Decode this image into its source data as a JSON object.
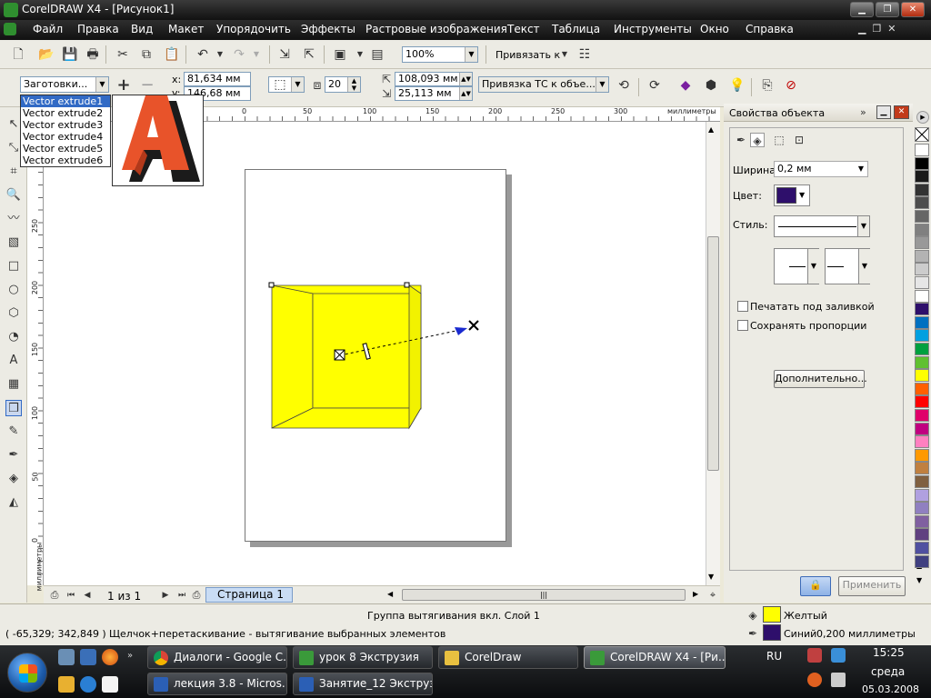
{
  "window": {
    "title": "CorelDRAW X4 - [Рисунок1]"
  },
  "menu": [
    "Файл",
    "Правка",
    "Вид",
    "Макет",
    "Упорядочить",
    "Эффекты",
    "Растровые изображения",
    "Текст",
    "Таблица",
    "Инструменты",
    "Окно",
    "Справка"
  ],
  "standard_toolbar": {
    "zoom": "100%",
    "snap_label": "Привязать к"
  },
  "property_bar": {
    "presets_value": "Заготовки...",
    "x": "81,634 мм",
    "y": "146,68 мм",
    "depth": "20",
    "vp_x": "108,093 мм",
    "vp_y": "25,113 мм",
    "vp_lock": "Привязка ТС к объе..."
  },
  "presets_list": {
    "items": [
      "Vector extrude1",
      "Vector extrude2",
      "Vector extrude3",
      "Vector extrude4",
      "Vector extrude5",
      "Vector extrude6"
    ],
    "selected_index": 0
  },
  "ruler": {
    "unit": "миллиметры",
    "h_ticks": [
      "0",
      "50",
      "100",
      "150",
      "200",
      "250",
      "300"
    ],
    "v_ticks": [
      "250",
      "200",
      "150",
      "100",
      "50",
      "0"
    ],
    "v_unit": "миллиметры"
  },
  "page_nav": {
    "counter": "1 из 1",
    "tab": "Страница 1"
  },
  "docker": {
    "title": "Свойства объекта",
    "width_label": "Ширина:",
    "width_value": "0,2 мм",
    "color_label": "Цвет:",
    "color_value": "#2e0f6b",
    "style_label": "Стиль:",
    "print_behind": "Печатать под заливкой",
    "keep_proportions": "Сохранять пропорции",
    "more_button": "Дополнительно...",
    "apply_button": "Применить"
  },
  "palette": [
    "#ffffff",
    "#000000",
    "#1a1a1a",
    "#333333",
    "#4d4d4d",
    "#666666",
    "#808080",
    "#999999",
    "#b3b3b3",
    "#cccccc",
    "#e6e6e6",
    "#ffffff",
    "#2e0f6b",
    "#0070c0",
    "#00a0e0",
    "#00a040",
    "#60c030",
    "#ffff00",
    "#ff6000",
    "#ff0000",
    "#e0006a",
    "#c00080",
    "#ff80c0",
    "#ff9900",
    "#c08040",
    "#806040",
    "#b0a0e0",
    "#9080c0",
    "#8060a0",
    "#604080",
    "#5050a0",
    "#404080"
  ],
  "status": {
    "line1": "Группа вытягивания вкл. Слой 1",
    "coords": "( -65,329; 342,849 )",
    "hint": "Щелчок+перетаскивание - вытягивание выбранных элементов",
    "fill_name": "Желтый",
    "fill_color": "#ffff00",
    "outline_name": "Синий",
    "outline_width": "0,200 миллиметры",
    "outline_color": "#2e0f6b"
  },
  "taskbar": {
    "tasks_row1": [
      "Диалоги - Google C...",
      "урок 8 Экструзия",
      "CorelDraw",
      "CorelDRAW X4 - [Ри..."
    ],
    "tasks_row2": [
      "лекция 3.8 - Micros...",
      "Занятие_12 Экструз..."
    ],
    "lang": "RU",
    "time": "15:25",
    "day": "среда",
    "date": "05.03.2008"
  },
  "colors": {
    "fill": "#ffff00",
    "accent": "#316ac5"
  }
}
